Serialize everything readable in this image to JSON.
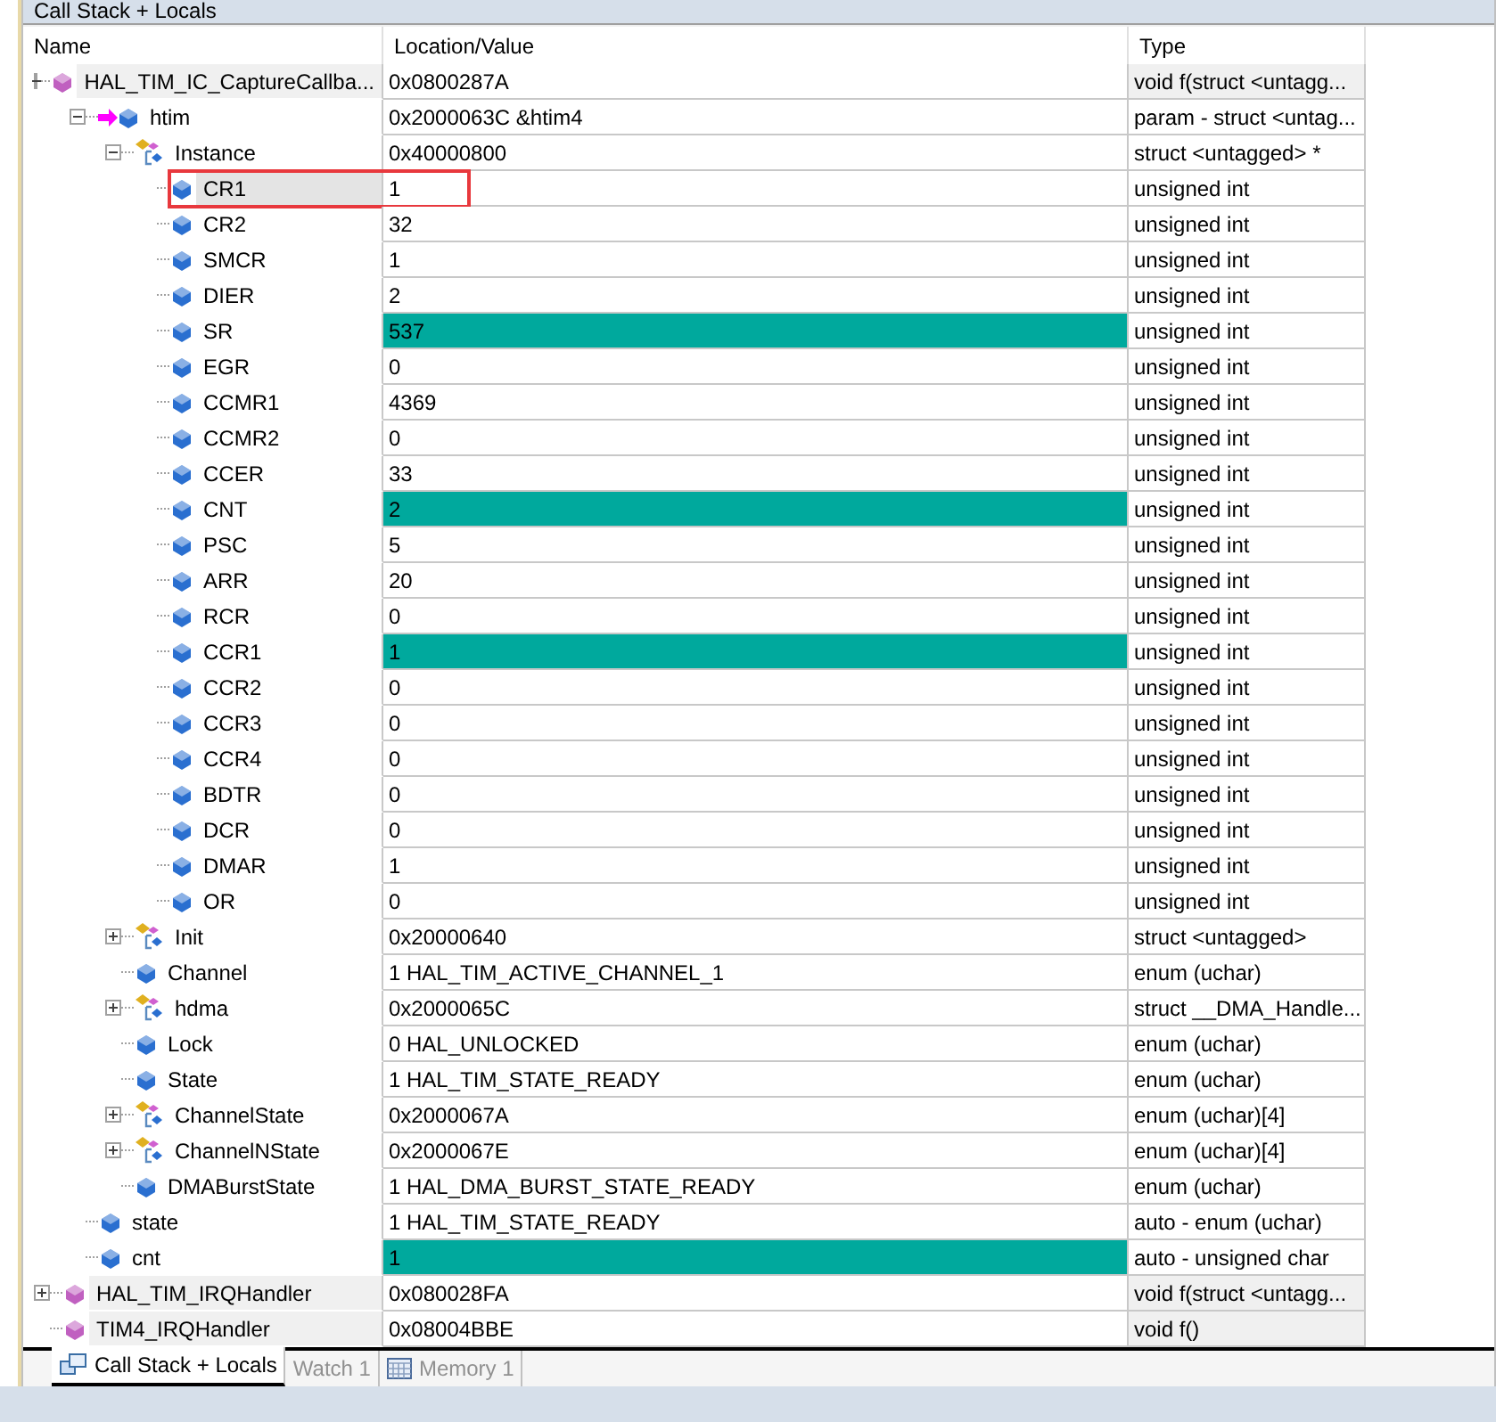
{
  "window": {
    "title": "Call Stack + Locals"
  },
  "columns": [
    "Name",
    "Location/Value",
    "Type"
  ],
  "rows": [
    {
      "name": "HAL_TIM_IC_CaptureCallba...",
      "value": "0x0800287A",
      "type": "void f(struct <untagg...",
      "kind": "function",
      "expanded": true,
      "changed": false,
      "selected": false,
      "outlined": false,
      "children": [
        {
          "name": "htim",
          "value": "0x2000063C &htim4",
          "type": "param - struct <untag...",
          "kind": "param",
          "expanded": true,
          "changed": false,
          "selected": false,
          "outlined": false,
          "children": [
            {
              "name": "Instance",
              "value": "0x40000800",
              "type": "struct <untagged> *",
              "kind": "struct",
              "expanded": true,
              "changed": false,
              "selected": false,
              "outlined": false,
              "children": [
                {
                  "name": "CR1",
                  "value": "1",
                  "type": "unsigned int",
                  "kind": "member",
                  "changed": false,
                  "selected": true,
                  "outlined": true
                },
                {
                  "name": "CR2",
                  "value": "32",
                  "type": "unsigned int",
                  "kind": "member",
                  "changed": false,
                  "selected": false,
                  "outlined": false
                },
                {
                  "name": "SMCR",
                  "value": "1",
                  "type": "unsigned int",
                  "kind": "member",
                  "changed": false,
                  "selected": false,
                  "outlined": false
                },
                {
                  "name": "DIER",
                  "value": "2",
                  "type": "unsigned int",
                  "kind": "member",
                  "changed": false,
                  "selected": false,
                  "outlined": false
                },
                {
                  "name": "SR",
                  "value": "537",
                  "type": "unsigned int",
                  "kind": "member",
                  "changed": true,
                  "selected": false,
                  "outlined": false
                },
                {
                  "name": "EGR",
                  "value": "0",
                  "type": "unsigned int",
                  "kind": "member",
                  "changed": false,
                  "selected": false,
                  "outlined": false
                },
                {
                  "name": "CCMR1",
                  "value": "4369",
                  "type": "unsigned int",
                  "kind": "member",
                  "changed": false,
                  "selected": false,
                  "outlined": false
                },
                {
                  "name": "CCMR2",
                  "value": "0",
                  "type": "unsigned int",
                  "kind": "member",
                  "changed": false,
                  "selected": false,
                  "outlined": false
                },
                {
                  "name": "CCER",
                  "value": "33",
                  "type": "unsigned int",
                  "kind": "member",
                  "changed": false,
                  "selected": false,
                  "outlined": false
                },
                {
                  "name": "CNT",
                  "value": "2",
                  "type": "unsigned int",
                  "kind": "member",
                  "changed": true,
                  "selected": false,
                  "outlined": false
                },
                {
                  "name": "PSC",
                  "value": "5",
                  "type": "unsigned int",
                  "kind": "member",
                  "changed": false,
                  "selected": false,
                  "outlined": false
                },
                {
                  "name": "ARR",
                  "value": "20",
                  "type": "unsigned int",
                  "kind": "member",
                  "changed": false,
                  "selected": false,
                  "outlined": false
                },
                {
                  "name": "RCR",
                  "value": "0",
                  "type": "unsigned int",
                  "kind": "member",
                  "changed": false,
                  "selected": false,
                  "outlined": false
                },
                {
                  "name": "CCR1",
                  "value": "1",
                  "type": "unsigned int",
                  "kind": "member",
                  "changed": true,
                  "selected": false,
                  "outlined": false
                },
                {
                  "name": "CCR2",
                  "value": "0",
                  "type": "unsigned int",
                  "kind": "member",
                  "changed": false,
                  "selected": false,
                  "outlined": false
                },
                {
                  "name": "CCR3",
                  "value": "0",
                  "type": "unsigned int",
                  "kind": "member",
                  "changed": false,
                  "selected": false,
                  "outlined": false
                },
                {
                  "name": "CCR4",
                  "value": "0",
                  "type": "unsigned int",
                  "kind": "member",
                  "changed": false,
                  "selected": false,
                  "outlined": false
                },
                {
                  "name": "BDTR",
                  "value": "0",
                  "type": "unsigned int",
                  "kind": "member",
                  "changed": false,
                  "selected": false,
                  "outlined": false
                },
                {
                  "name": "DCR",
                  "value": "0",
                  "type": "unsigned int",
                  "kind": "member",
                  "changed": false,
                  "selected": false,
                  "outlined": false
                },
                {
                  "name": "DMAR",
                  "value": "1",
                  "type": "unsigned int",
                  "kind": "member",
                  "changed": false,
                  "selected": false,
                  "outlined": false
                },
                {
                  "name": "OR",
                  "value": "0",
                  "type": "unsigned int",
                  "kind": "member",
                  "changed": false,
                  "selected": false,
                  "outlined": false
                }
              ]
            },
            {
              "name": "Init",
              "value": "0x20000640",
              "type": "struct <untagged>",
              "kind": "struct",
              "expanded": false,
              "changed": false,
              "selected": false,
              "outlined": false
            },
            {
              "name": "Channel",
              "value": "1 HAL_TIM_ACTIVE_CHANNEL_1",
              "type": "enum (uchar)",
              "kind": "member",
              "changed": false,
              "selected": false,
              "outlined": false
            },
            {
              "name": "hdma",
              "value": "0x2000065C",
              "type": "struct __DMA_Handle...",
              "kind": "struct",
              "expanded": false,
              "changed": false,
              "selected": false,
              "outlined": false
            },
            {
              "name": "Lock",
              "value": "0 HAL_UNLOCKED",
              "type": "enum (uchar)",
              "kind": "member",
              "changed": false,
              "selected": false,
              "outlined": false
            },
            {
              "name": "State",
              "value": "1 HAL_TIM_STATE_READY",
              "type": "enum (uchar)",
              "kind": "member",
              "changed": false,
              "selected": false,
              "outlined": false
            },
            {
              "name": "ChannelState",
              "value": "0x2000067A",
              "type": "enum (uchar)[4]",
              "kind": "struct",
              "expanded": false,
              "changed": false,
              "selected": false,
              "outlined": false
            },
            {
              "name": "ChannelNState",
              "value": "0x2000067E",
              "type": "enum (uchar)[4]",
              "kind": "struct",
              "expanded": false,
              "changed": false,
              "selected": false,
              "outlined": false
            },
            {
              "name": "DMABurstState",
              "value": "1 HAL_DMA_BURST_STATE_READY",
              "type": "enum (uchar)",
              "kind": "member",
              "changed": false,
              "selected": false,
              "outlined": false
            }
          ]
        },
        {
          "name": "state",
          "value": "1 HAL_TIM_STATE_READY",
          "type": "auto - enum (uchar)",
          "kind": "member",
          "changed": false,
          "selected": false,
          "outlined": false
        },
        {
          "name": "cnt",
          "value": "1",
          "type": "auto - unsigned char",
          "kind": "member",
          "changed": true,
          "selected": false,
          "outlined": false
        }
      ]
    },
    {
      "name": "HAL_TIM_IRQHandler",
      "value": "0x080028FA",
      "type": "void f(struct <untagg...",
      "kind": "function",
      "expanded": false,
      "changed": false,
      "selected": false,
      "outlined": false
    },
    {
      "name": "TIM4_IRQHandler",
      "value": "0x08004BBE",
      "type": "void f()",
      "kind": "function",
      "changed": false,
      "selected": false,
      "outlined": false
    }
  ],
  "tabs": [
    {
      "label": "Call Stack + Locals",
      "selected": true
    },
    {
      "label": "Watch 1",
      "selected": false
    },
    {
      "label": "Memory 1",
      "selected": false
    }
  ]
}
